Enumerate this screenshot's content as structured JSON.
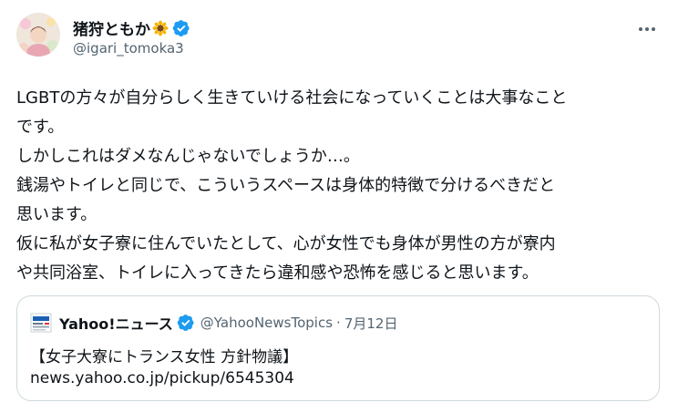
{
  "author": {
    "display_name": "猪狩ともか",
    "handle": "@igari_tomoka3",
    "avatar_icon": "avatar",
    "verified_icon": "verified-badge-icon",
    "name_emoji_icon": "sunflower-icon"
  },
  "menu": {
    "more_icon": "more-options-icon"
  },
  "tweet": {
    "lines": [
      "LGBTの方々が自分らしく生きていける社会になっていくことは大事なこと",
      "です。",
      "しかしこれはダメなんじゃないでしょうか…。",
      "銭湯やトイレと同じで、こういうスペースは身体的特徴で分けるべきだと",
      "思います。",
      "仮に私が女子寮に住んでいたとして、心が女性でも身体が男性の方が寮内",
      "や共同浴室、トイレに入ってきたら違和感や恐怖を感じると思います。"
    ]
  },
  "quote": {
    "logo_icon": "yahoo-news-logo",
    "name": "Yahoo!ニュース",
    "handle": "@YahooNewsTopics",
    "separator": "·",
    "date": "7月12日",
    "headline": "【女子大寮にトランス女性 方針物議】",
    "link": "news.yahoo.co.jp/pickup/6545304"
  },
  "colors": {
    "text": "#0f1419",
    "secondary": "#536471",
    "verified_blue": "#1d9bf0",
    "border": "#cfd9de"
  }
}
